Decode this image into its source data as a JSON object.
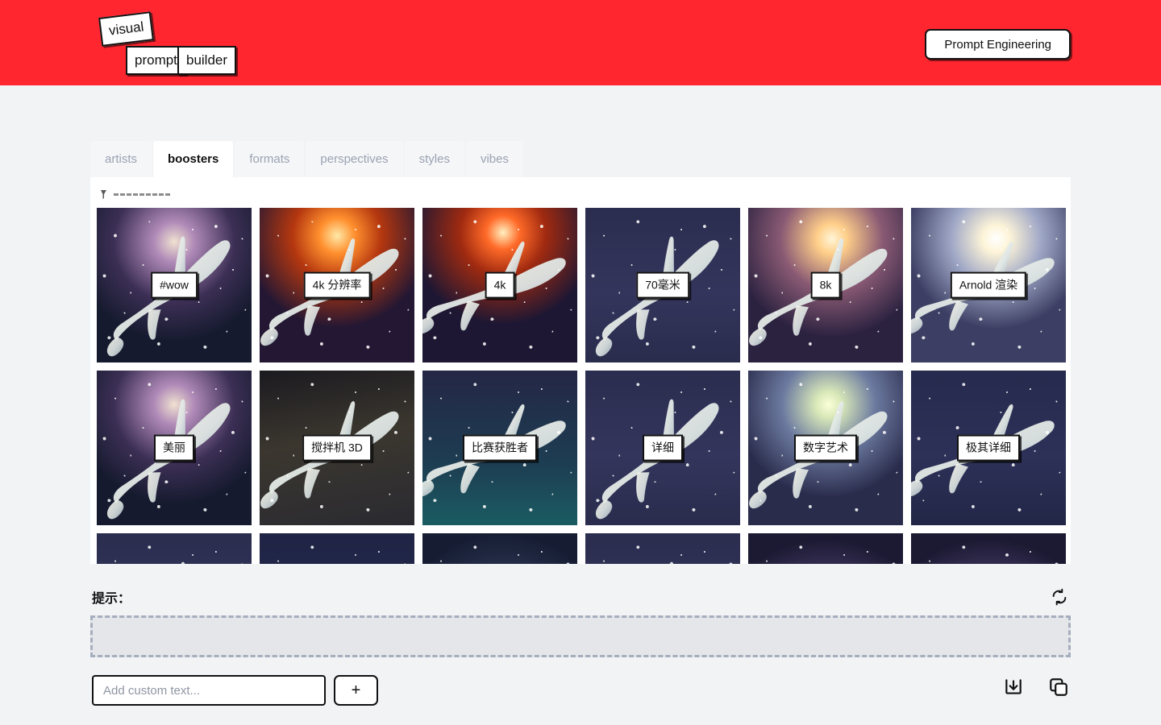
{
  "header": {
    "brand_color": "#ff2630",
    "logo": {
      "line1": "visual",
      "line2a": "prompt",
      "line2b": "builder"
    },
    "action_button": "Prompt Engineering"
  },
  "tabs": [
    {
      "label": "artists",
      "active": false
    },
    {
      "label": "boosters",
      "active": true
    },
    {
      "label": "formats",
      "active": false
    },
    {
      "label": "perspectives",
      "active": false
    },
    {
      "label": "styles",
      "active": false
    },
    {
      "label": "vibes",
      "active": false
    }
  ],
  "panel": {
    "toolbar_icon": "filter-icon",
    "cards": [
      {
        "label": "#wow",
        "art": "purple-nebula"
      },
      {
        "label": "4k 分辨率",
        "art": "orange-sun"
      },
      {
        "label": "4k",
        "art": "red-sun"
      },
      {
        "label": "70毫米",
        "art": "confetti-stars"
      },
      {
        "label": "8k",
        "art": "pink-glow"
      },
      {
        "label": "Arnold 渲染",
        "art": "bright-sun"
      },
      {
        "label": "美丽",
        "art": "purple-nebula"
      },
      {
        "label": "搅拌机 3D",
        "art": "dark-smoke"
      },
      {
        "label": "比赛获胜者",
        "art": "aurora-waves"
      },
      {
        "label": "详细",
        "art": "confetti-stars"
      },
      {
        "label": "数字艺术",
        "art": "moon-glow"
      },
      {
        "label": "极其详细",
        "art": "deep-space"
      },
      {
        "label": "",
        "art": "confetti-stars"
      },
      {
        "label": "",
        "art": "ribbed-whale"
      },
      {
        "label": "",
        "art": "blue-haze"
      },
      {
        "label": "",
        "art": "confetti-stars"
      },
      {
        "label": "",
        "art": "violet-glow"
      },
      {
        "label": "",
        "art": "violet-glow"
      }
    ]
  },
  "prompt": {
    "label": "提示：",
    "refresh_icon": "refresh-icon",
    "dropzone_value": ""
  },
  "custom": {
    "placeholder": "Add custom text...",
    "value": "",
    "add_label": "+",
    "download_icon": "download-icon",
    "copy_icon": "copy-icon"
  }
}
